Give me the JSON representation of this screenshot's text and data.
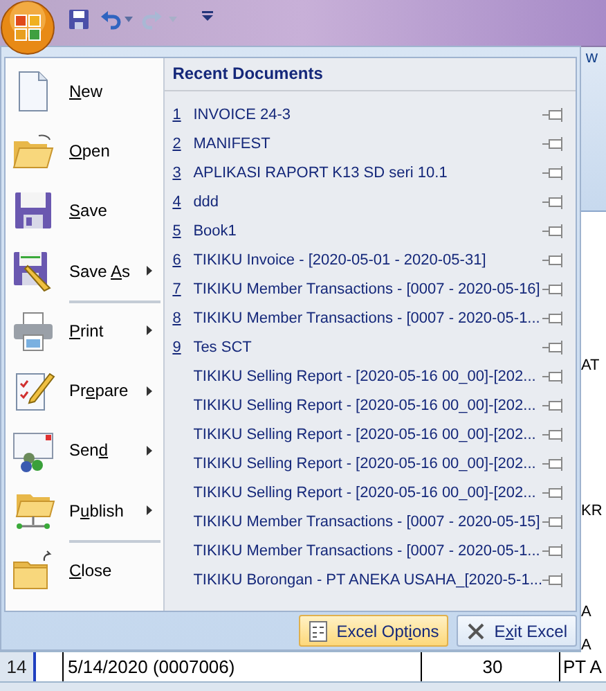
{
  "ribbon_fragment": "w",
  "menu": {
    "commands": [
      {
        "key": "N",
        "post": "ew",
        "submenu": false,
        "separator_before": false
      },
      {
        "key": "O",
        "post": "pen",
        "submenu": false,
        "separator_before": false
      },
      {
        "key": "S",
        "post": "ave",
        "submenu": false,
        "separator_before": false
      },
      {
        "pre": "Save ",
        "key": "A",
        "post": "s",
        "submenu": true,
        "separator_before": false
      },
      {
        "key": "P",
        "post": "rint",
        "submenu": true,
        "separator_before": true
      },
      {
        "pre": "Pr",
        "key": "e",
        "post": "pare",
        "submenu": true,
        "separator_before": false
      },
      {
        "pre": "Sen",
        "key": "d",
        "submenu": true,
        "separator_before": false
      },
      {
        "pre": "P",
        "key": "u",
        "post": "blish",
        "submenu": true,
        "separator_before": false
      },
      {
        "key": "C",
        "post": "lose",
        "submenu": false,
        "separator_before": true
      }
    ],
    "recent": {
      "title": "Recent Documents",
      "items": [
        {
          "number": "1",
          "name": "INVOICE 24-3",
          "pinned": false
        },
        {
          "number": "2",
          "name": "MANIFEST",
          "pinned": false
        },
        {
          "number": "3",
          "name": "APLIKASI RAPORT K13 SD seri 10.1",
          "pinned": false
        },
        {
          "number": "4",
          "name": "ddd",
          "pinned": false
        },
        {
          "number": "5",
          "name": "Book1",
          "pinned": false
        },
        {
          "number": "6",
          "name": "TIKIKU Invoice - [2020-05-01 - 2020-05-31]",
          "pinned": false
        },
        {
          "number": "7",
          "name": "TIKIKU Member Transactions - [0007 - 2020-05-16]",
          "pinned": false
        },
        {
          "number": "8",
          "name": "TIKIKU Member Transactions - [0007 - 2020-05-1...",
          "pinned": false
        },
        {
          "number": "9",
          "name": "Tes SCT",
          "pinned": false
        },
        {
          "name": "TIKIKU Selling Report - [2020-05-16 00_00]-[202...",
          "pinned": false
        },
        {
          "name": "TIKIKU Selling Report - [2020-05-16 00_00]-[202...",
          "pinned": false
        },
        {
          "name": "TIKIKU Selling Report - [2020-05-16 00_00]-[202...",
          "pinned": false
        },
        {
          "name": "TIKIKU Selling Report - [2020-05-16 00_00]-[202...",
          "pinned": false
        },
        {
          "name": "TIKIKU Selling Report - [2020-05-16 00_00]-[202...",
          "pinned": false
        },
        {
          "name": "TIKIKU Member Transactions - [0007 - 2020-05-15]",
          "pinned": false
        },
        {
          "name": "TIKIKU Member Transactions - [0007 - 2020-05-1...",
          "pinned": false
        },
        {
          "name": "TIKIKU Borongan - PT ANEKA USAHA_[2020-5-1...",
          "pinned": false
        }
      ]
    },
    "footer": [
      {
        "pre": "Excel Opt",
        "key": "i",
        "post": "ons",
        "highlighted": true
      },
      {
        "pre": "E",
        "key": "x",
        "post": "it Excel",
        "highlighted": false
      }
    ]
  },
  "sheet": {
    "right_cells": [
      "AT",
      "KR",
      "A",
      "A"
    ],
    "rows": [
      {
        "header": "14",
        "cells": [
          "",
          "5/14/2020 (0007006)",
          "30",
          "PT A"
        ]
      }
    ]
  }
}
